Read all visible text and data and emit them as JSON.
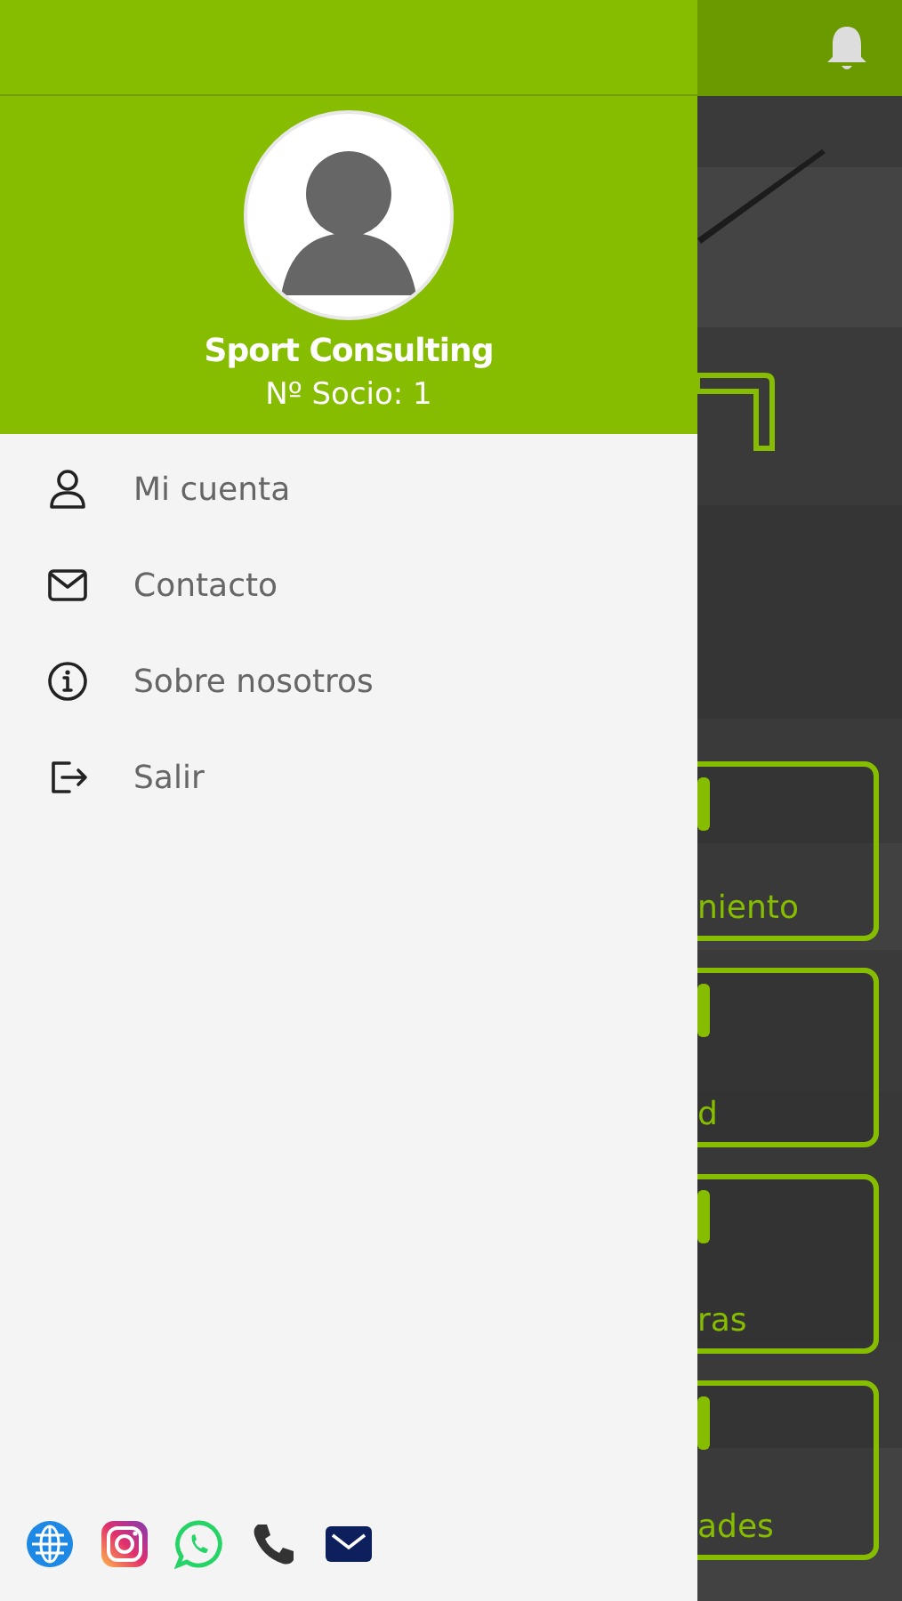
{
  "profile": {
    "name": "Sport Consulting",
    "member_number": "Nº Socio: 1"
  },
  "menu": [
    {
      "kind": "account",
      "label": "Mi cuenta"
    },
    {
      "kind": "contact",
      "label": "Contacto"
    },
    {
      "kind": "about",
      "label": "Sobre nosotros"
    },
    {
      "kind": "logout",
      "label": "Salir"
    }
  ],
  "social": [
    {
      "kind": "web"
    },
    {
      "kind": "instagram"
    },
    {
      "kind": "whatsapp"
    },
    {
      "kind": "phone"
    },
    {
      "kind": "email"
    }
  ],
  "background_cards": [
    {
      "label": "niento"
    },
    {
      "label": "d"
    },
    {
      "label": "ras"
    },
    {
      "label": "ades"
    }
  ]
}
